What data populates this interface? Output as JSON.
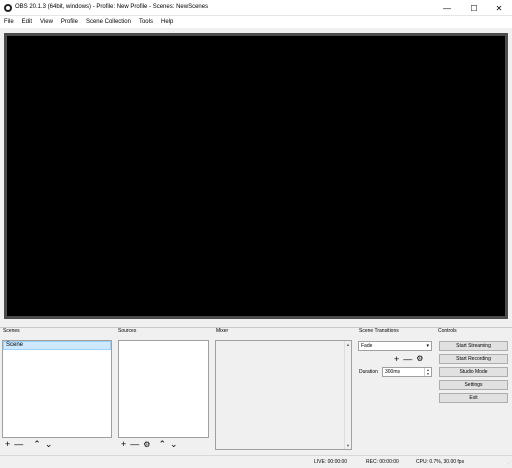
{
  "window": {
    "title": "OBS 20.1.3 (64bit, windows) - Profile: New Profile - Scenes: NewScenes",
    "minimize_symbol": "—",
    "maximize_symbol": "☐",
    "close_symbol": "✕"
  },
  "menu": {
    "items": [
      "File",
      "Edit",
      "View",
      "Profile",
      "Scene Collection",
      "Tools",
      "Help"
    ]
  },
  "docks": {
    "scenes": {
      "title": "Scenes",
      "items": [
        "Scene"
      ],
      "add": "+",
      "remove": "—",
      "up": "⌃",
      "down": "⌄"
    },
    "sources": {
      "title": "Sources",
      "add": "+",
      "remove": "—",
      "settings": "⚙",
      "up": "⌃",
      "down": "⌄"
    },
    "mixer": {
      "title": "Mixer",
      "scroll_up": "▲",
      "scroll_down": "▼"
    },
    "transitions": {
      "title": "Scene Transitions",
      "selected": "Fade",
      "add": "+",
      "remove": "—",
      "settings": "⚙",
      "duration_label": "Duration",
      "duration_value": "300ms"
    },
    "controls": {
      "title": "Controls",
      "buttons": [
        "Start Streaming",
        "Start Recording",
        "Studio Mode",
        "Settings",
        "Exit"
      ]
    }
  },
  "status": {
    "live": "LIVE: 00:00:00",
    "rec": "REC: 00:00:00",
    "cpu": "CPU: 0.7%, 30.00 fps"
  },
  "colors": {
    "preview_background": "#000000",
    "selection": "#cde8ff"
  }
}
